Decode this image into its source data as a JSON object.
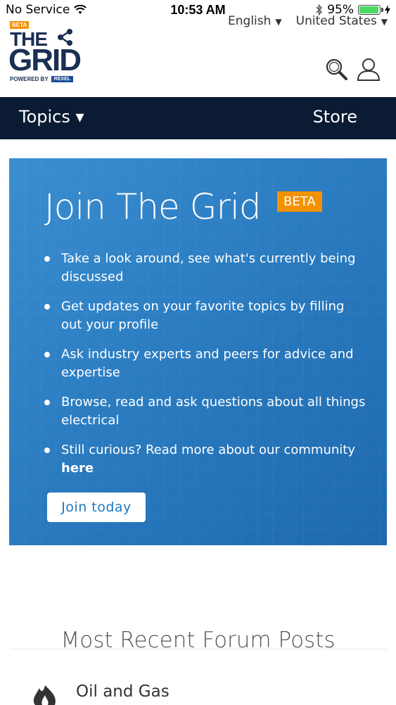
{
  "status_bar": {
    "carrier": "No Service",
    "time": "10:53 AM",
    "battery_pct": "95%",
    "battery_level": 0.95,
    "battery_color": "#4cd964"
  },
  "locale": {
    "language": "English",
    "country": "United States"
  },
  "header": {
    "logo_badge": "BETA",
    "logo_line1": "THE",
    "logo_line2": "GRID",
    "logo_powered": "POWERED BY",
    "logo_brand": "REXEL",
    "icons": [
      "search-icon",
      "user-icon"
    ]
  },
  "nav": {
    "topics": "Topics ▾",
    "store": "Store",
    "background": "#0a1b33"
  },
  "hero": {
    "title": "Join The Grid",
    "badge": "BETA",
    "badge_color": "#f39200",
    "items": [
      "Take a look around, see what's currently being discussed",
      "Get updates on your favorite topics by filling out your profile",
      "Ask industry experts and peers for advice and expertise",
      "Browse, read and ask questions about all things electrical",
      "Still curious? Read more about our community"
    ],
    "item_link": "here",
    "button": "Join today",
    "accent": "#2b7cc1"
  },
  "recent": {
    "title": "Most Recent Forum Posts",
    "posts": [
      {
        "title": "Oil and Gas",
        "icon": "flame-icon"
      }
    ]
  }
}
